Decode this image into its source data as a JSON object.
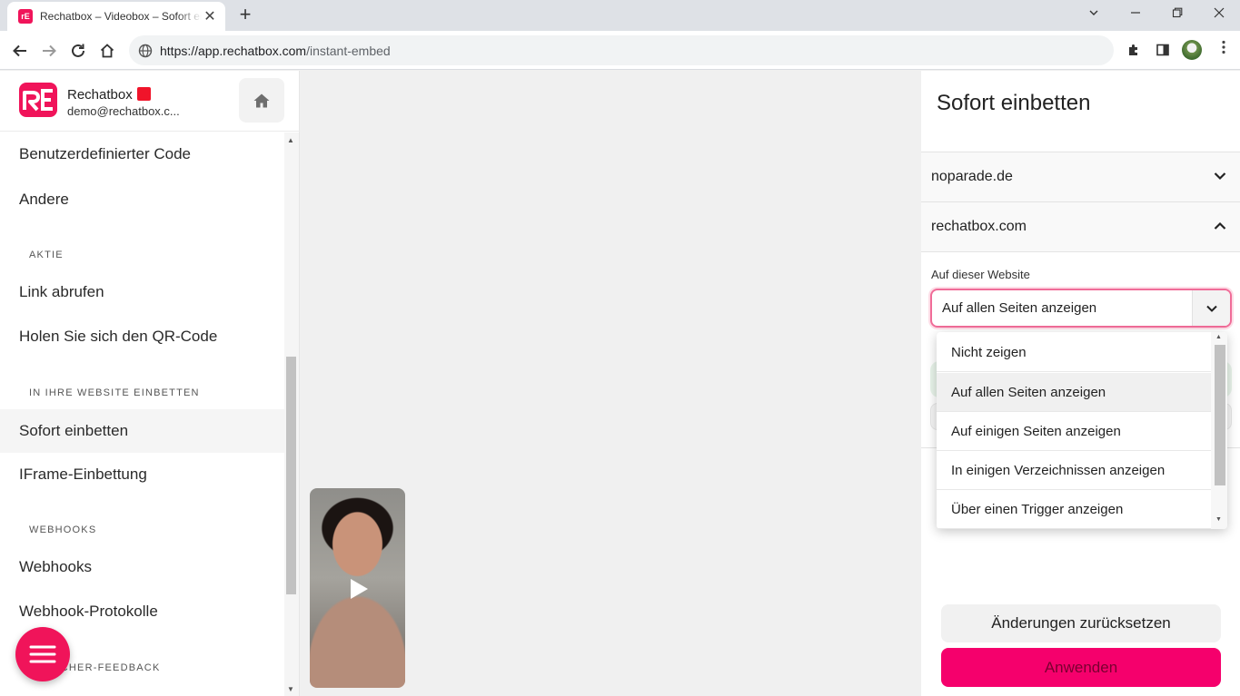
{
  "browser": {
    "tab_title": "Rechatbox – Videobox – Sofort einbetten",
    "favicon_text": "rE",
    "close_glyph": "✕",
    "new_tab_glyph": "+",
    "url_host": "https://app.rechatbox.com",
    "url_path": "/instant-embed"
  },
  "sidebar": {
    "brand_name": "Rechatbox",
    "brand_email": "demo@rechatbox.c...",
    "items": [
      {
        "label": "Benutzerdefinierter Code"
      },
      {
        "label": "Andere"
      },
      {
        "label": "Link abrufen"
      },
      {
        "label": "Holen Sie sich den QR-Code"
      },
      {
        "label": "Sofort einbetten"
      },
      {
        "label": "IFrame-Einbettung"
      },
      {
        "label": "Webhooks"
      },
      {
        "label": "Webhook-Protokolle"
      }
    ],
    "sections": [
      {
        "label": "AKTIE"
      },
      {
        "label": "IN IHRE WEBSITE EINBETTEN"
      },
      {
        "label": "WEBHOOKS"
      },
      {
        "label": "BESUCHER-FEEDBACK"
      }
    ]
  },
  "panel": {
    "title": "Sofort einbetten",
    "accordion": [
      {
        "label": "noparade.de",
        "expanded": false
      },
      {
        "label": "rechatbox.com",
        "expanded": true
      }
    ],
    "field_label": "Auf dieser Website",
    "selected_value": "Auf allen Seiten anzeigen",
    "options": [
      {
        "label": "Nicht zeigen"
      },
      {
        "label": "Auf allen Seiten anzeigen"
      },
      {
        "label": "Auf einigen Seiten anzeigen"
      },
      {
        "label": "In einigen Verzeichnissen anzeigen"
      },
      {
        "label": "Über einen Trigger anzeigen"
      }
    ],
    "reset_label": "Änderungen zurücksetzen",
    "apply_label": "Anwenden"
  },
  "colors": {
    "brand": "#f0145a",
    "apply": "#f5006c"
  }
}
